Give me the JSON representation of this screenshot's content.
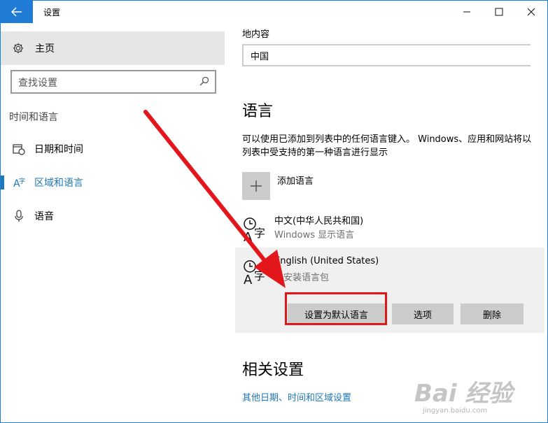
{
  "window": {
    "title": "设置",
    "back_icon": "back-arrow-icon",
    "controls": [
      "minimize-icon",
      "maximize-icon",
      "close-icon"
    ]
  },
  "sidebar": {
    "home_label": "主页",
    "home_icon": "gear-icon",
    "search_placeholder": "查找设置",
    "section_label": "时间和语言",
    "items": [
      {
        "label": "日期和时间",
        "icon": "calendar-clock-icon",
        "active": false
      },
      {
        "label": "区域和语言",
        "icon": "language-region-icon",
        "active": true
      },
      {
        "label": "语音",
        "icon": "microphone-icon",
        "active": false
      }
    ]
  },
  "main": {
    "region_label": "地内容",
    "region_value": "中国",
    "language_heading": "语言",
    "language_description": "可以使用已添加到列表中的任何语言键入。 Windows、应用和网站将以列表中受支持的第一种语言进行显示",
    "add_language_label": "添加语言",
    "languages": [
      {
        "name": "中文(中华人民共和国)",
        "status": "Windows 显示语言",
        "selected": false
      },
      {
        "name": "English (United States)",
        "status": "已安装语言包",
        "selected": true
      }
    ],
    "buttons": {
      "set_default": "设置为默认语言",
      "options": "选项",
      "remove": "删除"
    },
    "related_heading": "相关设置",
    "related_link": "其他日期、时间和区域设置"
  },
  "annotation": {
    "color": "#e3161c"
  },
  "watermark": {
    "text": "Bai 经验",
    "sub": "jingyan.baidu.com"
  },
  "colors": {
    "accent": "#1f78b6",
    "titlebar_back": "#1f7bd3"
  }
}
